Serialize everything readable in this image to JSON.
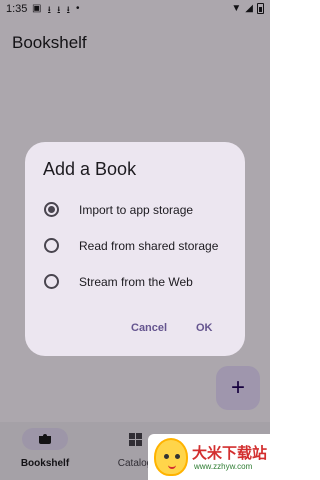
{
  "status_bar": {
    "time": "1:35",
    "left_icons": [
      "image-icon",
      "download-icon",
      "download-icon",
      "download-icon",
      "dot-icon"
    ],
    "right_icons": [
      "wifi-icon",
      "signal-icon",
      "battery-icon"
    ]
  },
  "app_bar": {
    "title": "Bookshelf"
  },
  "fab": {
    "icon": "add-icon",
    "glyph": "+"
  },
  "bottom_nav": {
    "items": [
      {
        "label": "Bookshelf",
        "icon": "book-icon",
        "active": true
      },
      {
        "label": "Catalog",
        "icon": "grid-icon",
        "active": false
      }
    ]
  },
  "dialog": {
    "title": "Add a Book",
    "options": [
      {
        "label": "Import to app storage",
        "selected": true
      },
      {
        "label": "Read from shared storage",
        "selected": false
      },
      {
        "label": "Stream from the Web",
        "selected": false
      }
    ],
    "cancel_label": "Cancel",
    "ok_label": "OK"
  },
  "watermark": {
    "text": "大米下载站",
    "url": "www.zzhyw.com"
  },
  "colors": {
    "surface": "#fef7ff",
    "dialog": "#ece6f0",
    "accent": "#65558f",
    "fab": "#eaddff"
  }
}
